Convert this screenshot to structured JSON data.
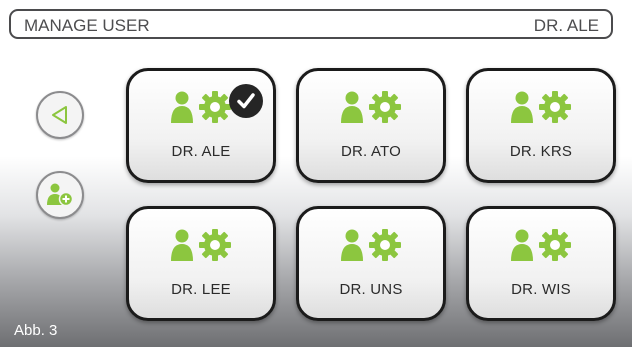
{
  "header": {
    "title": "MANAGE USER",
    "current_user": "DR. ALE"
  },
  "side_buttons": {
    "back_icon": "back-triangle-icon",
    "add_icon": "add-user-icon"
  },
  "users": [
    {
      "label": "DR. ALE",
      "selected": true
    },
    {
      "label": "DR. ATO",
      "selected": false
    },
    {
      "label": "DR. KRS",
      "selected": false
    },
    {
      "label": "DR. LEE",
      "selected": false
    },
    {
      "label": "DR. UNS",
      "selected": false
    },
    {
      "label": "DR. WIS",
      "selected": false
    }
  ],
  "caption": "Abb. 3",
  "colors": {
    "accent_green": "#8cc63f",
    "border_dark": "#1b1b1b",
    "text_gray": "#4d4d4f"
  }
}
